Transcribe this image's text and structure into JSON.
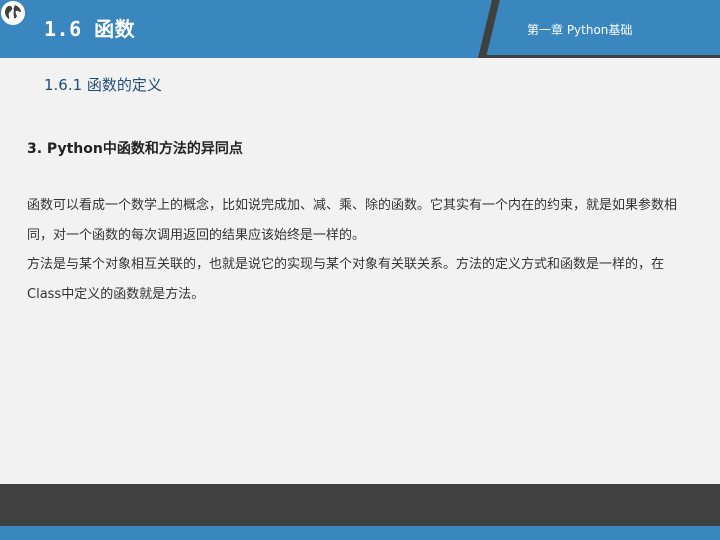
{
  "header": {
    "section_title": "1.6 函数",
    "chapter_label": "第一章 Python基础"
  },
  "content": {
    "subsection_title": "1.6.1 函数的定义",
    "heading": "3. Python中函数和方法的异同点",
    "paragraphs": [
      "函数可以看成一个数学上的概念，比如说完成加、减、乘、除的函数。它其实有一个内在的约束，就是如果参数相同，对一个函数的每次调用返回的结果应该始终是一样的。",
      "方法是与某个对象相互关联的，也就是说它的实现与某个对象有关联关系。方法的定义方式和函数是一样的，在Class中定义的函数就是方法。"
    ]
  },
  "colors": {
    "header_blue": "#3a87c0",
    "header_dark": "#404040",
    "footer_dark": "#404040",
    "footer_blue": "#3a87c0",
    "background": "#f2f2f2"
  },
  "icons": {
    "section_icon": "globe-icon"
  }
}
